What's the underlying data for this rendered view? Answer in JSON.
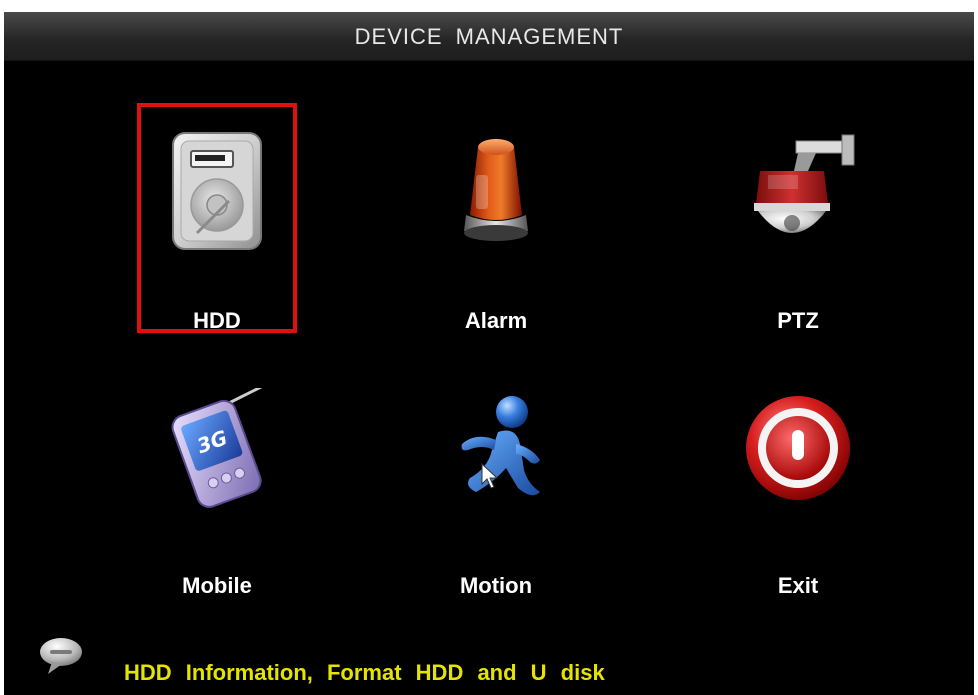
{
  "title": "DEVICE MANAGEMENT",
  "menu": {
    "items": [
      {
        "id": "hdd",
        "label": "HDD",
        "icon": "hdd-icon",
        "selected": true
      },
      {
        "id": "alarm",
        "label": "Alarm",
        "icon": "alarm-beacon-icon",
        "selected": false
      },
      {
        "id": "ptz",
        "label": "PTZ",
        "icon": "ptz-camera-icon",
        "selected": false
      },
      {
        "id": "mobile",
        "label": "Mobile",
        "icon": "mobile-3g-icon",
        "selected": false
      },
      {
        "id": "motion",
        "label": "Motion",
        "icon": "motion-runner-icon",
        "selected": false
      },
      {
        "id": "exit",
        "label": "Exit",
        "icon": "power-icon",
        "selected": false
      }
    ]
  },
  "status": {
    "icon": "speech-bubble-icon",
    "text": "HDD  Information, Format  HDD  and  U  disk"
  },
  "colors": {
    "background": "#000000",
    "selection": "#e01010",
    "status_text": "#e4e400",
    "label": "#ffffff"
  }
}
